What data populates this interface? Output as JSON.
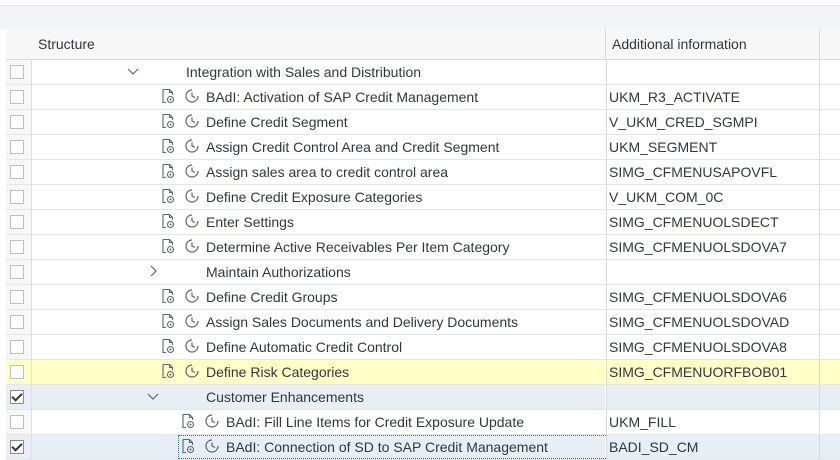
{
  "header": {
    "structure": "Structure",
    "additional": "Additional information"
  },
  "rows": [
    {
      "label": "Integration with Sales and Distribution",
      "info": "",
      "level": 0,
      "node": "expanded",
      "icons": false,
      "checked": false
    },
    {
      "label": "BAdI: Activation of SAP Credit Management",
      "info": "UKM_R3_ACTIVATE",
      "level": 1,
      "node": "leaf",
      "icons": true,
      "checked": false
    },
    {
      "label": "Define Credit Segment",
      "info": "V_UKM_CRED_SGMPI",
      "level": 1,
      "node": "leaf",
      "icons": true,
      "checked": false
    },
    {
      "label": "Assign Credit Control Area and Credit Segment",
      "info": "UKM_SEGMENT",
      "level": 1,
      "node": "leaf",
      "icons": true,
      "checked": false
    },
    {
      "label": "Assign sales area to credit control area",
      "info": "SIMG_CFMENUSAPOVFL",
      "level": 1,
      "node": "leaf",
      "icons": true,
      "checked": false
    },
    {
      "label": "Define Credit Exposure Categories",
      "info": "V_UKM_COM_0C",
      "level": 1,
      "node": "leaf",
      "icons": true,
      "checked": false
    },
    {
      "label": "Enter Settings",
      "info": "SIMG_CFMENUOLSDECT",
      "level": 1,
      "node": "leaf",
      "icons": true,
      "checked": false
    },
    {
      "label": "Determine Active Receivables Per Item Category",
      "info": "SIMG_CFMENUOLSDOVA7",
      "level": 1,
      "node": "leaf",
      "icons": true,
      "checked": false
    },
    {
      "label": "Maintain Authorizations",
      "info": "",
      "level": 1,
      "node": "collapsed",
      "icons": false,
      "checked": false
    },
    {
      "label": "Define Credit Groups",
      "info": "SIMG_CFMENUOLSDOVA6",
      "level": 1,
      "node": "leaf",
      "icons": true,
      "checked": false
    },
    {
      "label": "Assign Sales Documents and Delivery Documents",
      "info": "SIMG_CFMENUOLSDOVAD",
      "level": 1,
      "node": "leaf",
      "icons": true,
      "checked": false
    },
    {
      "label": "Define Automatic Credit Control",
      "info": "SIMG_CFMENUOLSDOVA8",
      "level": 1,
      "node": "leaf",
      "icons": true,
      "checked": false
    },
    {
      "label": "Define Risk Categories",
      "info": "SIMG_CFMENUORFBOB01",
      "level": 1,
      "node": "leaf",
      "icons": true,
      "checked": false,
      "highlight": true
    },
    {
      "label": "Customer Enhancements",
      "info": "",
      "level": 1,
      "node": "expanded",
      "icons": false,
      "checked": true,
      "selected": true
    },
    {
      "label": "BAdI: Fill Line Items for Credit Exposure Update",
      "info": "UKM_FILL",
      "level": 2,
      "node": "leaf",
      "icons": true,
      "checked": false
    },
    {
      "label": "BAdI: Connection of SD to SAP Credit Management",
      "info": "BADI_SD_CM",
      "level": 2,
      "node": "leaf",
      "icons": true,
      "checked": true,
      "selected": true,
      "focused": true
    }
  ],
  "icons": {
    "doc": "execute-document-icon",
    "clock": "clock-icon",
    "expand": "chevron-down-icon",
    "collapse": "chevron-right-icon"
  },
  "colors": {
    "highlight_row": "#ffffc8",
    "selected_row": "#e8eef4",
    "icon": "#5a6470"
  }
}
